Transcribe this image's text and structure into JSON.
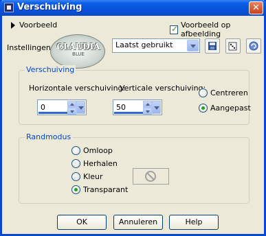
{
  "window": {
    "title": "Verschuiving",
    "close_symbol": "✕"
  },
  "preview": {
    "toggle_label": "Voorbeeld",
    "on_image_label": "Voorbeeld op afbeelding",
    "on_image_checked": true
  },
  "settings": {
    "label": "Instellingen",
    "logo_text": "CLAUDIA",
    "logo_subtext": "BLUE",
    "preset_value": "Laatst gebruikt",
    "buttons": {
      "save": "save-preset-icon",
      "random": "randomize-dice-icon",
      "reset": "reset-icon"
    }
  },
  "offset": {
    "legend": "Verschuiving",
    "horizontal_label": "Horizontale verschuiving:",
    "horizontal_value": "0",
    "vertical_label": "Verticale verschuiving:",
    "vertical_value": "50",
    "center_label": "Centreren",
    "custom_label": "Aangepast",
    "selected": "custom"
  },
  "edge": {
    "legend": "Randmodus",
    "options": [
      "Omloop",
      "Herhalen",
      "Kleur",
      "Transparant"
    ],
    "selected": "Transparant"
  },
  "buttons": {
    "ok": "OK",
    "cancel": "Annuleren",
    "help": "Help"
  }
}
